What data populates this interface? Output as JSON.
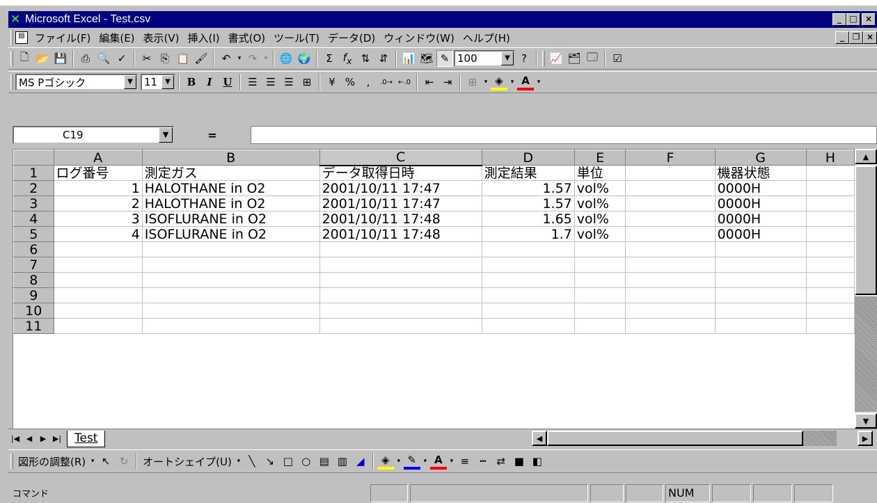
{
  "window": {
    "title": "Microsoft Excel - Test.csv",
    "icon": "excel-icon"
  },
  "menu": [
    "ファイル(F)",
    "編集(E)",
    "表示(V)",
    "挿入(I)",
    "書式(O)",
    "ツール(T)",
    "データ(D)",
    "ウィンドウ(W)",
    "ヘルプ(H)"
  ],
  "toolbar": {
    "zoom": "100"
  },
  "format": {
    "font": "MS Pゴシック",
    "size": "11"
  },
  "formula": {
    "cell_ref": "C19",
    "equals": "=",
    "value": ""
  },
  "sheet": {
    "columns": [
      "A",
      "B",
      "C",
      "D",
      "E",
      "F",
      "G",
      "H"
    ],
    "selected_column": "C",
    "row_numbers": [
      "1",
      "2",
      "3",
      "4",
      "5",
      "6",
      "7",
      "8",
      "9",
      "10",
      "11"
    ],
    "header": [
      "ログ番号",
      "測定ガス",
      "データ取得日時",
      "測定結果",
      "単位",
      "",
      "機器状態"
    ],
    "rows": [
      [
        "1",
        "HALOTHANE in O2",
        "2001/10/11 17:47",
        "1.57",
        "vol%",
        "",
        "0000H"
      ],
      [
        "2",
        "HALOTHANE in O2",
        "2001/10/11 17:47",
        "1.57",
        "vol%",
        "",
        "0000H"
      ],
      [
        "3",
        "ISOFLURANE in O2",
        "2001/10/11 17:48",
        "1.65",
        "vol%",
        "",
        "0000H"
      ],
      [
        "4",
        "ISOFLURANE in O2",
        "2001/10/11 17:48",
        "1.7",
        "vol%",
        "",
        "0000H"
      ]
    ]
  },
  "tabs": [
    {
      "label": "Test",
      "active": true
    }
  ],
  "drawing": {
    "draw_label": "図形の調整(R)",
    "autoshape_label": "オートシェイプ(U)"
  },
  "status": {
    "text": "コマンド",
    "num": "NUM"
  }
}
